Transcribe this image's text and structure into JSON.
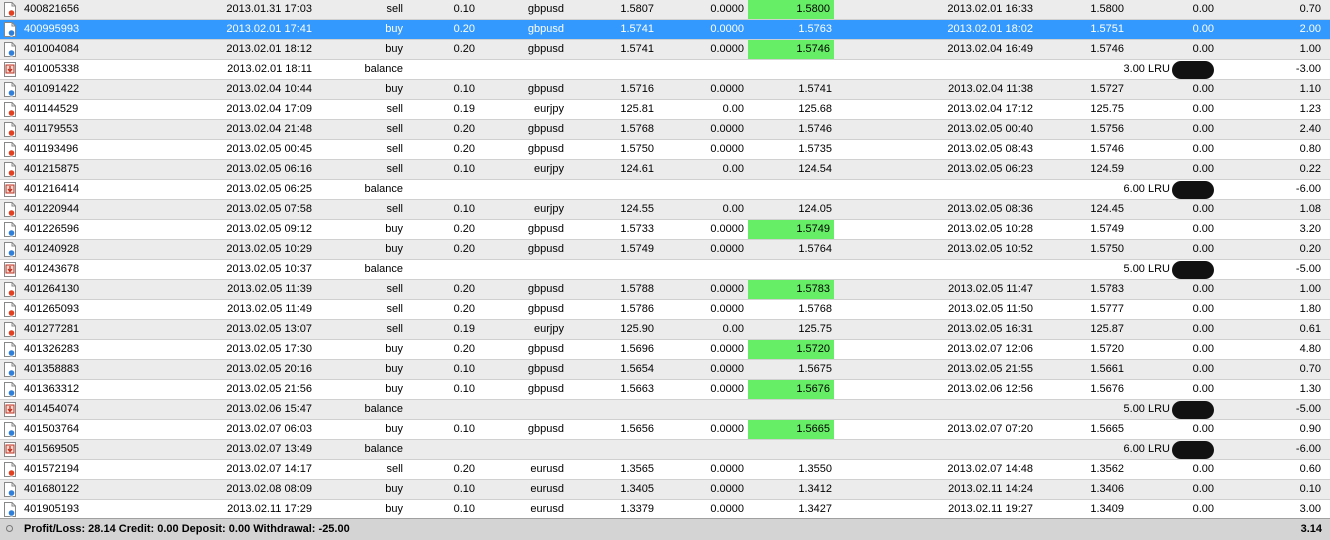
{
  "colors": {
    "selected_row": "#3399ff",
    "take_profit_hit": "#66ee66",
    "alt_row": "#ececec"
  },
  "rows": [
    {
      "ticket": "400821656",
      "open_time": "2013.01.31 17:03",
      "type": "sell",
      "size": "0.10",
      "item": "gbpusd",
      "open_price": "1.5807",
      "sl": "0.0000",
      "tp": "1.5800",
      "close_time": "2013.02.01 16:33",
      "close_price": "1.5800",
      "commission": "0.00",
      "profit": "0.70",
      "tp_hit": true,
      "icon": "trade-sell-icon"
    },
    {
      "ticket": "400995993",
      "open_time": "2013.02.01 17:41",
      "type": "buy",
      "size": "0.20",
      "item": "gbpusd",
      "open_price": "1.5741",
      "sl": "0.0000",
      "tp": "1.5763",
      "close_time": "2013.02.01 18:02",
      "close_price": "1.5751",
      "commission": "0.00",
      "profit": "2.00",
      "tp_hit": false,
      "selected": true,
      "icon": "trade-buy-icon"
    },
    {
      "ticket": "401004084",
      "open_time": "2013.02.01 18:12",
      "type": "buy",
      "size": "0.20",
      "item": "gbpusd",
      "open_price": "1.5741",
      "sl": "0.0000",
      "tp": "1.5746",
      "close_time": "2013.02.04 16:49",
      "close_price": "1.5746",
      "commission": "0.00",
      "profit": "1.00",
      "tp_hit": true,
      "icon": "trade-buy-icon"
    },
    {
      "ticket": "401005338",
      "open_time": "2013.02.01 18:11",
      "type": "balance",
      "balance_text": "3.00 LRU U",
      "profit": "-3.00",
      "icon": "balance-icon"
    },
    {
      "ticket": "401091422",
      "open_time": "2013.02.04 10:44",
      "type": "buy",
      "size": "0.10",
      "item": "gbpusd",
      "open_price": "1.5716",
      "sl": "0.0000",
      "tp": "1.5741",
      "close_time": "2013.02.04 11:38",
      "close_price": "1.5727",
      "commission": "0.00",
      "profit": "1.10",
      "tp_hit": false,
      "icon": "trade-buy-icon"
    },
    {
      "ticket": "401144529",
      "open_time": "2013.02.04 17:09",
      "type": "sell",
      "size": "0.19",
      "item": "eurjpy",
      "open_price": "125.81",
      "sl": "0.00",
      "tp": "125.68",
      "close_time": "2013.02.04 17:12",
      "close_price": "125.75",
      "commission": "0.00",
      "profit": "1.23",
      "tp_hit": false,
      "icon": "trade-sell-icon"
    },
    {
      "ticket": "401179553",
      "open_time": "2013.02.04 21:48",
      "type": "sell",
      "size": "0.20",
      "item": "gbpusd",
      "open_price": "1.5768",
      "sl": "0.0000",
      "tp": "1.5746",
      "close_time": "2013.02.05 00:40",
      "close_price": "1.5756",
      "commission": "0.00",
      "profit": "2.40",
      "tp_hit": false,
      "icon": "trade-sell-icon"
    },
    {
      "ticket": "401193496",
      "open_time": "2013.02.05 00:45",
      "type": "sell",
      "size": "0.20",
      "item": "gbpusd",
      "open_price": "1.5750",
      "sl": "0.0000",
      "tp": "1.5735",
      "close_time": "2013.02.05 08:43",
      "close_price": "1.5746",
      "commission": "0.00",
      "profit": "0.80",
      "tp_hit": false,
      "icon": "trade-sell-icon"
    },
    {
      "ticket": "401215875",
      "open_time": "2013.02.05 06:16",
      "type": "sell",
      "size": "0.10",
      "item": "eurjpy",
      "open_price": "124.61",
      "sl": "0.00",
      "tp": "124.54",
      "close_time": "2013.02.05 06:23",
      "close_price": "124.59",
      "commission": "0.00",
      "profit": "0.22",
      "tp_hit": false,
      "icon": "trade-sell-icon"
    },
    {
      "ticket": "401216414",
      "open_time": "2013.02.05 06:25",
      "type": "balance",
      "balance_text": "6.00 LRU U",
      "profit": "-6.00",
      "icon": "balance-icon"
    },
    {
      "ticket": "401220944",
      "open_time": "2013.02.05 07:58",
      "type": "sell",
      "size": "0.10",
      "item": "eurjpy",
      "open_price": "124.55",
      "sl": "0.00",
      "tp": "124.05",
      "close_time": "2013.02.05 08:36",
      "close_price": "124.45",
      "commission": "0.00",
      "profit": "1.08",
      "tp_hit": false,
      "icon": "trade-sell-icon"
    },
    {
      "ticket": "401226596",
      "open_time": "2013.02.05 09:12",
      "type": "buy",
      "size": "0.20",
      "item": "gbpusd",
      "open_price": "1.5733",
      "sl": "0.0000",
      "tp": "1.5749",
      "close_time": "2013.02.05 10:28",
      "close_price": "1.5749",
      "commission": "0.00",
      "profit": "3.20",
      "tp_hit": true,
      "icon": "trade-buy-icon"
    },
    {
      "ticket": "401240928",
      "open_time": "2013.02.05 10:29",
      "type": "buy",
      "size": "0.20",
      "item": "gbpusd",
      "open_price": "1.5749",
      "sl": "0.0000",
      "tp": "1.5764",
      "close_time": "2013.02.05 10:52",
      "close_price": "1.5750",
      "commission": "0.00",
      "profit": "0.20",
      "tp_hit": false,
      "icon": "trade-buy-icon"
    },
    {
      "ticket": "401243678",
      "open_time": "2013.02.05 10:37",
      "type": "balance",
      "balance_text": "5.00 LRU U",
      "profit": "-5.00",
      "icon": "balance-icon"
    },
    {
      "ticket": "401264130",
      "open_time": "2013.02.05 11:39",
      "type": "sell",
      "size": "0.20",
      "item": "gbpusd",
      "open_price": "1.5788",
      "sl": "0.0000",
      "tp": "1.5783",
      "close_time": "2013.02.05 11:47",
      "close_price": "1.5783",
      "commission": "0.00",
      "profit": "1.00",
      "tp_hit": true,
      "icon": "trade-sell-icon"
    },
    {
      "ticket": "401265093",
      "open_time": "2013.02.05 11:49",
      "type": "sell",
      "size": "0.20",
      "item": "gbpusd",
      "open_price": "1.5786",
      "sl": "0.0000",
      "tp": "1.5768",
      "close_time": "2013.02.05 11:50",
      "close_price": "1.5777",
      "commission": "0.00",
      "profit": "1.80",
      "tp_hit": false,
      "icon": "trade-sell-icon"
    },
    {
      "ticket": "401277281",
      "open_time": "2013.02.05 13:07",
      "type": "sell",
      "size": "0.19",
      "item": "eurjpy",
      "open_price": "125.90",
      "sl": "0.00",
      "tp": "125.75",
      "close_time": "2013.02.05 16:31",
      "close_price": "125.87",
      "commission": "0.00",
      "profit": "0.61",
      "tp_hit": false,
      "icon": "trade-sell-icon"
    },
    {
      "ticket": "401326283",
      "open_time": "2013.02.05 17:30",
      "type": "buy",
      "size": "0.20",
      "item": "gbpusd",
      "open_price": "1.5696",
      "sl": "0.0000",
      "tp": "1.5720",
      "close_time": "2013.02.07 12:06",
      "close_price": "1.5720",
      "commission": "0.00",
      "profit": "4.80",
      "tp_hit": true,
      "icon": "trade-buy-icon"
    },
    {
      "ticket": "401358883",
      "open_time": "2013.02.05 20:16",
      "type": "buy",
      "size": "0.10",
      "item": "gbpusd",
      "open_price": "1.5654",
      "sl": "0.0000",
      "tp": "1.5675",
      "close_time": "2013.02.05 21:55",
      "close_price": "1.5661",
      "commission": "0.00",
      "profit": "0.70",
      "tp_hit": false,
      "icon": "trade-buy-icon"
    },
    {
      "ticket": "401363312",
      "open_time": "2013.02.05 21:56",
      "type": "buy",
      "size": "0.10",
      "item": "gbpusd",
      "open_price": "1.5663",
      "sl": "0.0000",
      "tp": "1.5676",
      "close_time": "2013.02.06 12:56",
      "close_price": "1.5676",
      "commission": "0.00",
      "profit": "1.30",
      "tp_hit": true,
      "icon": "trade-buy-icon"
    },
    {
      "ticket": "401454074",
      "open_time": "2013.02.06 15:47",
      "type": "balance",
      "balance_text": "5.00 LRU U",
      "profit": "-5.00",
      "icon": "balance-icon"
    },
    {
      "ticket": "401503764",
      "open_time": "2013.02.07 06:03",
      "type": "buy",
      "size": "0.10",
      "item": "gbpusd",
      "open_price": "1.5656",
      "sl": "0.0000",
      "tp": "1.5665",
      "close_time": "2013.02.07 07:20",
      "close_price": "1.5665",
      "commission": "0.00",
      "profit": "0.90",
      "tp_hit": true,
      "icon": "trade-buy-icon"
    },
    {
      "ticket": "401569505",
      "open_time": "2013.02.07 13:49",
      "type": "balance",
      "balance_text": "6.00 LRU U",
      "profit": "-6.00",
      "icon": "balance-icon"
    },
    {
      "ticket": "401572194",
      "open_time": "2013.02.07 14:17",
      "type": "sell",
      "size": "0.20",
      "item": "eurusd",
      "open_price": "1.3565",
      "sl": "0.0000",
      "tp": "1.3550",
      "close_time": "2013.02.07 14:48",
      "close_price": "1.3562",
      "commission": "0.00",
      "profit": "0.60",
      "tp_hit": false,
      "icon": "trade-sell-icon"
    },
    {
      "ticket": "401680122",
      "open_time": "2013.02.08 08:09",
      "type": "buy",
      "size": "0.10",
      "item": "eurusd",
      "open_price": "1.3405",
      "sl": "0.0000",
      "tp": "1.3412",
      "close_time": "2013.02.11 14:24",
      "close_price": "1.3406",
      "commission": "0.00",
      "profit": "0.10",
      "tp_hit": false,
      "icon": "trade-buy-icon"
    },
    {
      "ticket": "401905193",
      "open_time": "2013.02.11 17:29",
      "type": "buy",
      "size": "0.10",
      "item": "eurusd",
      "open_price": "1.3379",
      "sl": "0.0000",
      "tp": "1.3427",
      "close_time": "2013.02.11 19:27",
      "close_price": "1.3409",
      "commission": "0.00",
      "profit": "3.00",
      "tp_hit": false,
      "icon": "trade-buy-icon"
    }
  ],
  "status_bar": {
    "summary": "Profit/Loss: 28.14  Credit: 0.00  Deposit: 0.00  Withdrawal: -25.00",
    "total": "3.14"
  }
}
